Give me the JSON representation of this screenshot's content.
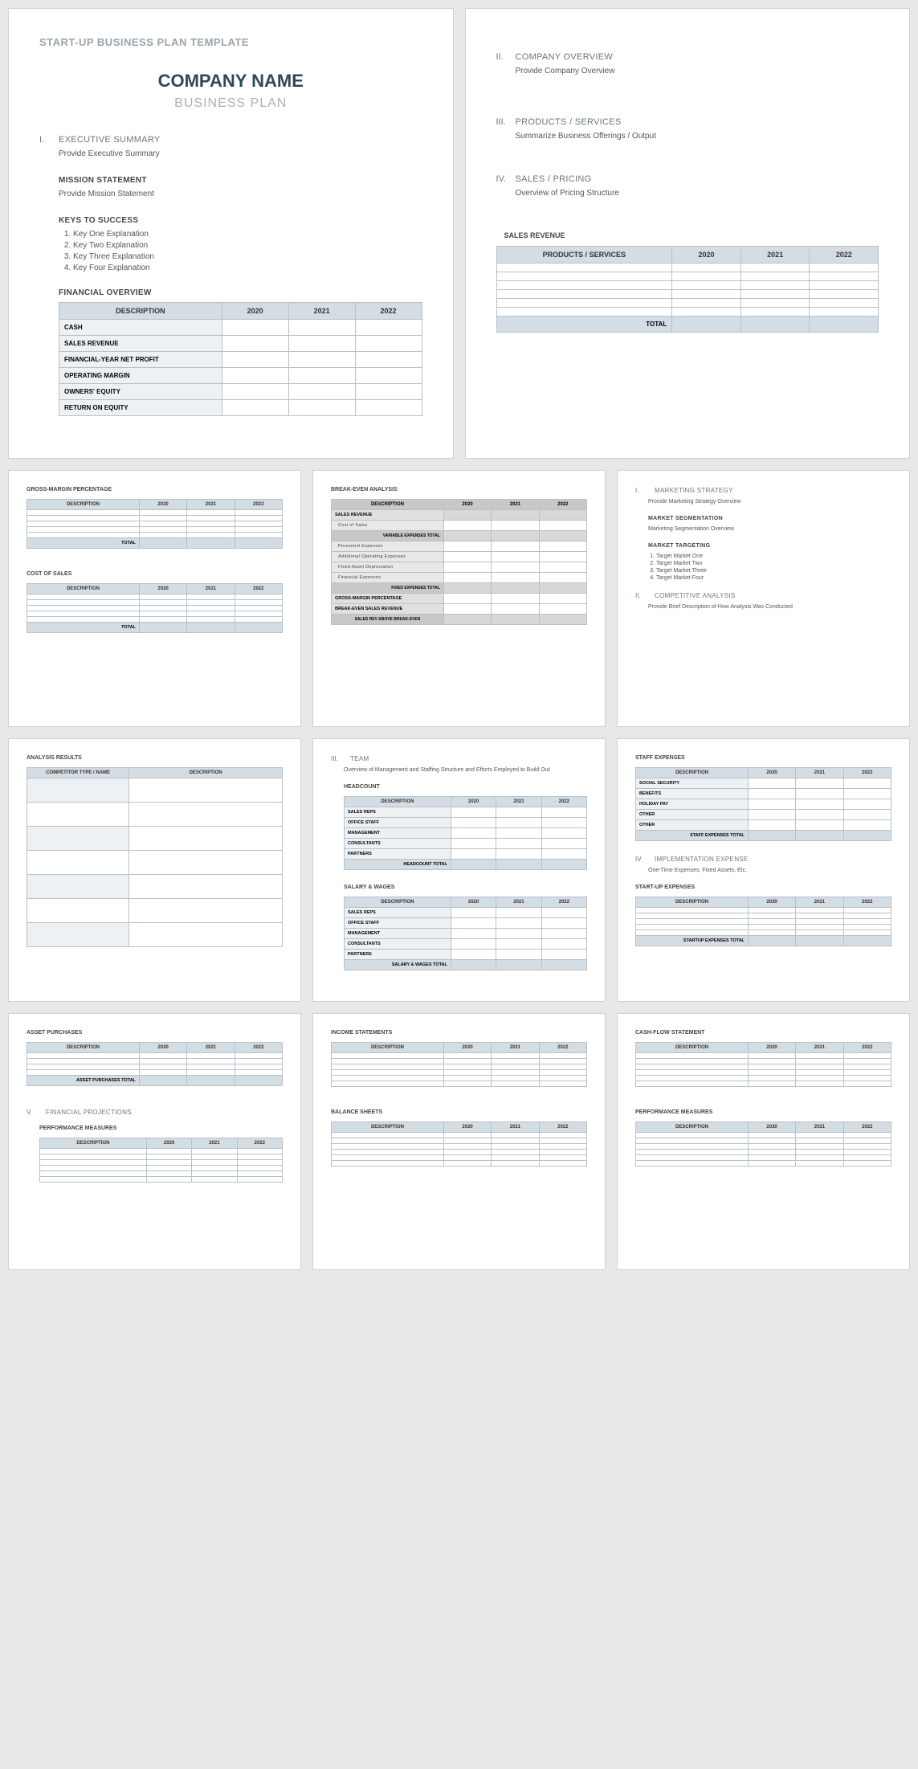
{
  "tmpl": "START-UP BUSINESS PLAN TEMPLATE",
  "co": "COMPANY NAME",
  "bp": "BUSINESS PLAN",
  "yrs": [
    "2020",
    "2021",
    "2022"
  ],
  "p1": {
    "s1": {
      "n": "I.",
      "t": "EXECUTIVE SUMMARY",
      "b": "Provide Executive Summary"
    },
    "ms": {
      "t": "MISSION STATEMENT",
      "b": "Provide Mission Statement"
    },
    "ks": {
      "t": "KEYS TO SUCCESS",
      "items": [
        "Key One Explanation",
        "Key Two Explanation",
        "Key Three Explanation",
        "Key Four Explanation"
      ]
    },
    "fo": {
      "t": "FINANCIAL OVERVIEW",
      "desc": "DESCRIPTION",
      "rows": [
        "CASH",
        "SALES REVENUE",
        "FINANCIAL-YEAR NET PROFIT",
        "OPERATING MARGIN",
        "OWNERS' EQUITY",
        "RETURN ON EQUITY"
      ]
    }
  },
  "p2": {
    "s2": {
      "n": "II.",
      "t": "COMPANY OVERVIEW",
      "b": "Provide Company Overview"
    },
    "s3": {
      "n": "III.",
      "t": "PRODUCTS / SERVICES",
      "b": "Summarize Business Offerings / Output"
    },
    "s4": {
      "n": "IV.",
      "t": "SALES / PRICING",
      "b": "Overview of Pricing Structure"
    },
    "sr": {
      "t": "SALES REVENUE",
      "h": "PRODUCTS / SERVICES",
      "tot": "TOTAL"
    }
  },
  "p3": {
    "gm": {
      "t": "GROSS-MARGIN PERCENTAGE",
      "d": "DESCRIPTION",
      "tot": "TOTAL"
    },
    "cs": {
      "t": "COST OF SALES",
      "d": "DESCRIPTION",
      "tot": "TOTAL"
    }
  },
  "p4": {
    "t": "BREAK-EVEN ANALYSIS",
    "d": "DESCRIPTION",
    "rows": [
      "SALES REVENUE",
      "Cost of Sales"
    ],
    "vet": "VARIABLE EXPENSES TOTAL",
    "rows2": [
      "Personnel Expenses",
      "Additional Operating Expenses",
      "Fixed-Asset Depreciation",
      "Financial Expenses"
    ],
    "fet": "FIXED EXPENSES TOTAL",
    "rows3": [
      "GROSS-MARGIN PERCENTAGE",
      "BREAK-EVEN SALES REVENUE"
    ],
    "sra": "SALES REV ABOVE BREAK-EVEN"
  },
  "p5": {
    "s1": {
      "n": "I.",
      "t": "MARKETING STRATEGY",
      "b": "Provide Marketing Strategy Overview"
    },
    "ms": {
      "t": "MARKET SEGMENTATION",
      "b": "Marketing Segmentation Overview"
    },
    "mt": {
      "t": "MARKET TARGETING",
      "items": [
        "Target Market One",
        "Target Market Two",
        "Target Market Three",
        "Target Market Four"
      ]
    },
    "s2": {
      "n": "II.",
      "t": "COMPETITIVE ANALYSIS",
      "b": "Provide Brief Description of How Analysis Was Conducted"
    }
  },
  "p6": {
    "t": "ANALYSIS RESULTS",
    "h1": "COMPETITOR TYPE / NAME",
    "h2": "DESCRIPTION"
  },
  "p7": {
    "s3": {
      "n": "III.",
      "t": "TEAM",
      "b": "Overview of Management and Staffing Structure and Efforts Employed to Build Out"
    },
    "hc": {
      "t": "HEADCOUNT",
      "d": "DESCRIPTION",
      "rows": [
        "SALES REPS",
        "OFFICE STAFF",
        "MANAGEMENT",
        "CONSULTANTS",
        "PARTNERS"
      ],
      "tot": "HEADCOUNT TOTAL"
    },
    "sw": {
      "t": "SALARY & WAGES",
      "d": "DESCRIPTION",
      "rows": [
        "SALES REPS",
        "OFFICE STAFF",
        "MANAGEMENT",
        "CONSULTANTS",
        "PARTNERS"
      ],
      "tot": "SALARY & WAGES TOTAL"
    }
  },
  "p8": {
    "se": {
      "t": "STAFF EXPENSES",
      "d": "DESCRIPTION",
      "rows": [
        "SOCIAL SECURITY",
        "BENEFITS",
        "HOLIDAY PAY",
        "OTHER",
        "OTHER"
      ],
      "tot": "STAFF EXPENSES TOTAL"
    },
    "s4": {
      "n": "IV.",
      "t": "IMPLEMENTATION EXPENSE",
      "b": "One-Time Expenses, Fixed Assets, Etc."
    },
    "su": {
      "t": "START-UP EXPENSES",
      "d": "DESCRIPTION",
      "tot": "STARTUP EXPENSES TOTAL"
    }
  },
  "p9": {
    "ap": {
      "t": "ASSET PURCHASES",
      "d": "DESCRIPTION",
      "tot": "ASSET PURCHASES TOTAL"
    },
    "s5": {
      "n": "V.",
      "t": "FINANCIAL PROJECTIONS"
    },
    "pm": {
      "t": "PERFORMANCE MEASURES",
      "d": "DESCRIPTION"
    }
  },
  "p10": {
    "is": {
      "t": "INCOME STATEMENTS",
      "d": "DESCRIPTION"
    },
    "bs": {
      "t": "BALANCE SHEETS",
      "d": "DESCRIPTION"
    }
  },
  "p11": {
    "cf": {
      "t": "CASH-FLOW STATEMENT",
      "d": "DESCRIPTION"
    },
    "pm": {
      "t": "PERFORMANCE MEASURES",
      "d": "DESCRIPTION"
    }
  }
}
